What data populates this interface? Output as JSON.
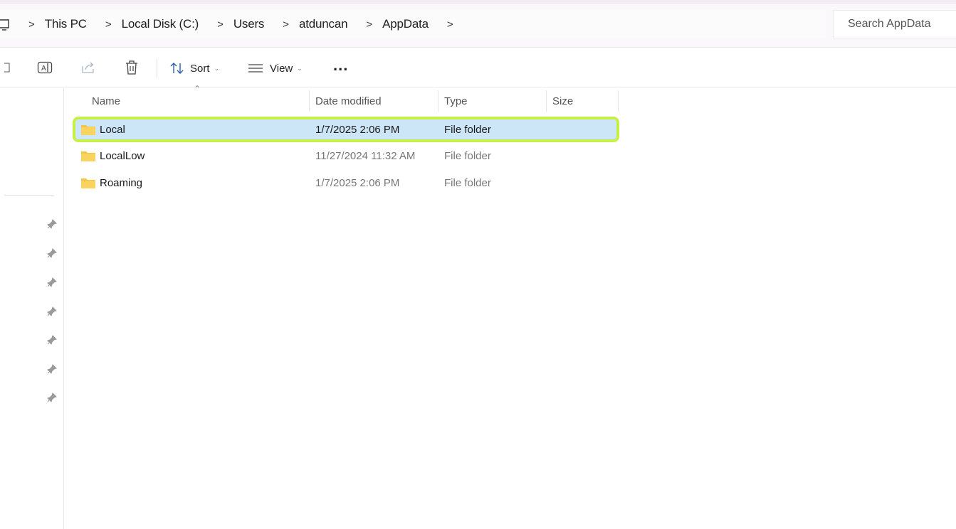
{
  "breadcrumb": {
    "items": [
      "This PC",
      "Local Disk (C:)",
      "Users",
      "atduncan",
      "AppData"
    ],
    "separator": ">"
  },
  "search": {
    "placeholder": "Search AppData"
  },
  "toolbar": {
    "sort_label": "Sort",
    "view_label": "View",
    "more_label": "..."
  },
  "columns": {
    "name": "Name",
    "date": "Date modified",
    "type": "Type",
    "size": "Size"
  },
  "files": [
    {
      "name": "Local",
      "date": "1/7/2025 2:06 PM",
      "type": "File folder",
      "size": "",
      "selected": true
    },
    {
      "name": "LocalLow",
      "date": "11/27/2024 11:32 AM",
      "type": "File folder",
      "size": "",
      "selected": false
    },
    {
      "name": "Roaming",
      "date": "1/7/2025 2:06 PM",
      "type": "File folder",
      "size": "",
      "selected": false
    }
  ],
  "colors": {
    "selection_fill": "#cde6f7",
    "selection_outline": "#c5f04a",
    "folder": "#f4c542"
  }
}
